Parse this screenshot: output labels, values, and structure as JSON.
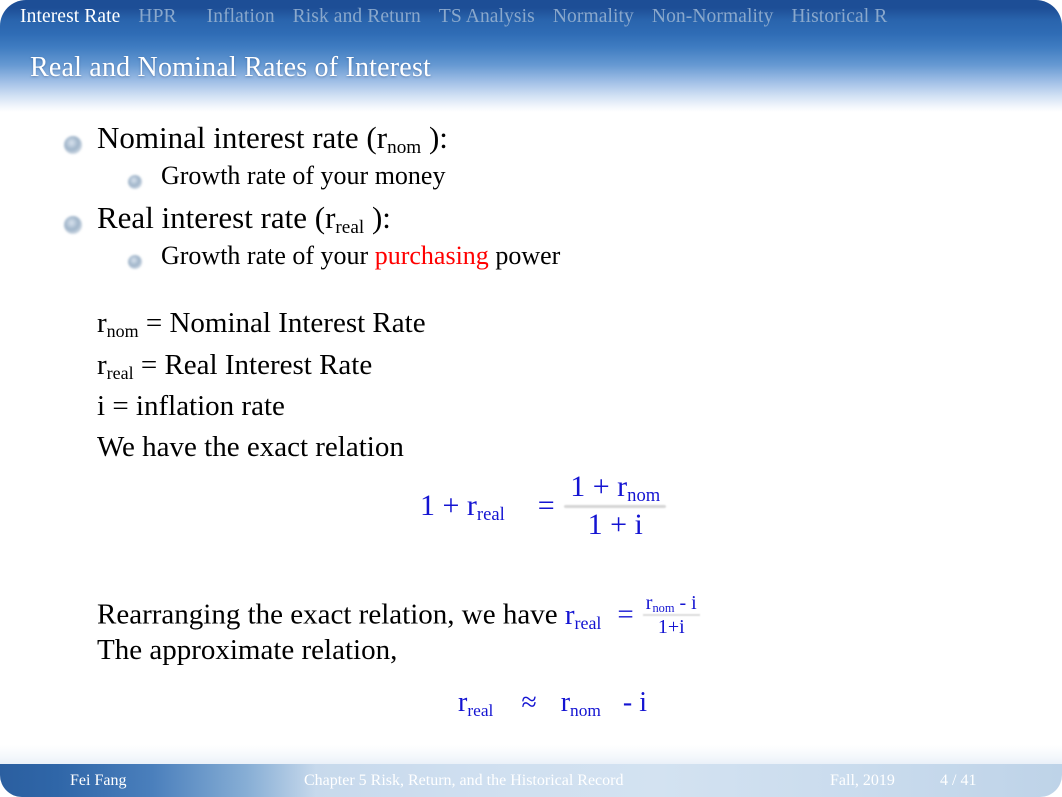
{
  "nav": {
    "items": [
      {
        "label": "Interest Rate",
        "active": true
      },
      {
        "label": "HPR",
        "active": false
      },
      {
        "label": "Inflation",
        "active": false
      },
      {
        "label": "Risk and Return",
        "active": false
      },
      {
        "label": "TS Analysis",
        "active": false
      },
      {
        "label": "Normality",
        "active": false
      },
      {
        "label": "Non-Normality",
        "active": false
      },
      {
        "label": "Historical R",
        "active": false
      }
    ]
  },
  "header": {
    "title": "Real and Nominal Rates of Interest",
    "accent_dark": "#1d4e96",
    "accent_light": "#ffffff"
  },
  "body": {
    "bullets": [
      {
        "level": 1,
        "text_before": "Nominal interest rate (r",
        "sub": "nom",
        "text_after": " ):"
      },
      {
        "level": 2,
        "text_before": "Growth rate of your money",
        "sub": "",
        "text_after": ""
      },
      {
        "level": 1,
        "text_before": "Real interest rate (r",
        "sub": "real",
        "text_after": " ):"
      },
      {
        "level": 2,
        "text_before": "Growth rate of your ",
        "highlight": "purchasing",
        "text_after": " power"
      }
    ],
    "bullet2_highlight_color": "#ff0000",
    "definitions": [
      {
        "symbol": "r",
        "sub": "nom",
        "rest": "  =  Nominal Interest Rate"
      },
      {
        "symbol": "r",
        "sub": "real",
        "rest": "  =  Real Interest Rate"
      },
      {
        "symbol": "i",
        "sub": "",
        "rest": " = inflation rate"
      },
      {
        "symbol": "",
        "sub": "",
        "rest": "We have the exact relation"
      }
    ],
    "equation_color": "#1414d2",
    "equation_exact": {
      "lhs_pre": "1 + r",
      "lhs_sub": "real",
      "operator": "=",
      "numerator_pre": "1 + r",
      "numerator_sub": "nom",
      "denominator": "1 + i"
    },
    "rearrange_line": {
      "text": "Rearranging the exact relation, we have ",
      "symbol": "r",
      "symbol_sub": "real",
      "operator": "=",
      "numerator_pre": "r",
      "numerator_sub": "nom",
      "numerator_post": " - i",
      "denominator": "1+i"
    },
    "approx_intro": "The approximate relation,",
    "equation_approx": {
      "lhs": "r",
      "lhs_sub": "real",
      "operator": "≈",
      "rhs": "r",
      "rhs_sub": "nom",
      "tail": " -  i"
    }
  },
  "footer": {
    "author": "Fei Fang",
    "chapter": "Chapter 5 Risk, Return, and the Historical Record",
    "term": "Fall, 2019",
    "page": "4 / 41"
  }
}
